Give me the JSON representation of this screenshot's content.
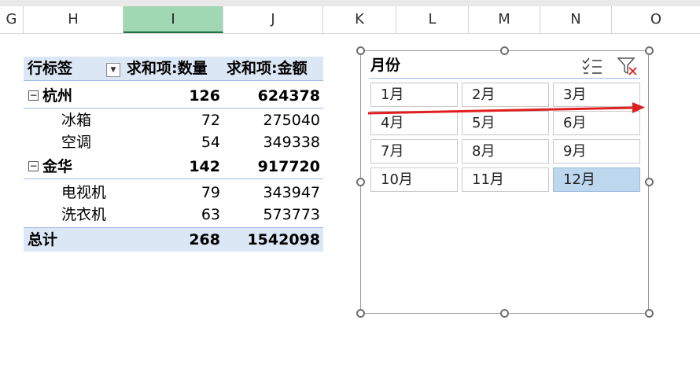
{
  "columns": [
    "G",
    "H",
    "I",
    "J",
    "K",
    "L",
    "M",
    "N",
    "O"
  ],
  "selected_column": "I",
  "pivot": {
    "header": {
      "row_label": "行标签",
      "col_qty": "求和项:数量",
      "col_amt": "求和项:金额"
    },
    "groups": [
      {
        "name": "杭州",
        "qty": "126",
        "amt": "624378",
        "items": [
          {
            "name": "冰箱",
            "qty": "72",
            "amt": "275040"
          },
          {
            "name": "空调",
            "qty": "54",
            "amt": "349338"
          }
        ]
      },
      {
        "name": "金华",
        "qty": "142",
        "amt": "917720",
        "items": [
          {
            "name": "电视机",
            "qty": "79",
            "amt": "343947"
          },
          {
            "name": "洗衣机",
            "qty": "63",
            "amt": "573773"
          }
        ]
      }
    ],
    "total": {
      "label": "总计",
      "qty": "268",
      "amt": "1542098"
    }
  },
  "slicer": {
    "title": "月份",
    "items": [
      {
        "label": "1月",
        "selected": false
      },
      {
        "label": "2月",
        "selected": false
      },
      {
        "label": "3月",
        "selected": false
      },
      {
        "label": "4月",
        "selected": false
      },
      {
        "label": "5月",
        "selected": false
      },
      {
        "label": "6月",
        "selected": false
      },
      {
        "label": "7月",
        "selected": false
      },
      {
        "label": "8月",
        "selected": false
      },
      {
        "label": "9月",
        "selected": false
      },
      {
        "label": "10月",
        "selected": false
      },
      {
        "label": "11月",
        "selected": false
      },
      {
        "label": "12月",
        "selected": true
      }
    ],
    "icons": {
      "multi_select": "multi-select-icon",
      "clear_filter": "clear-filter-icon"
    }
  },
  "colors": {
    "pivot_header_bg": "#dbe7f5",
    "pivot_border": "#9cbbe3",
    "selected_slicer_item": "#bdd7ee",
    "selected_column_header": "#a0d8b3",
    "annotation_arrow": "#e02020"
  }
}
